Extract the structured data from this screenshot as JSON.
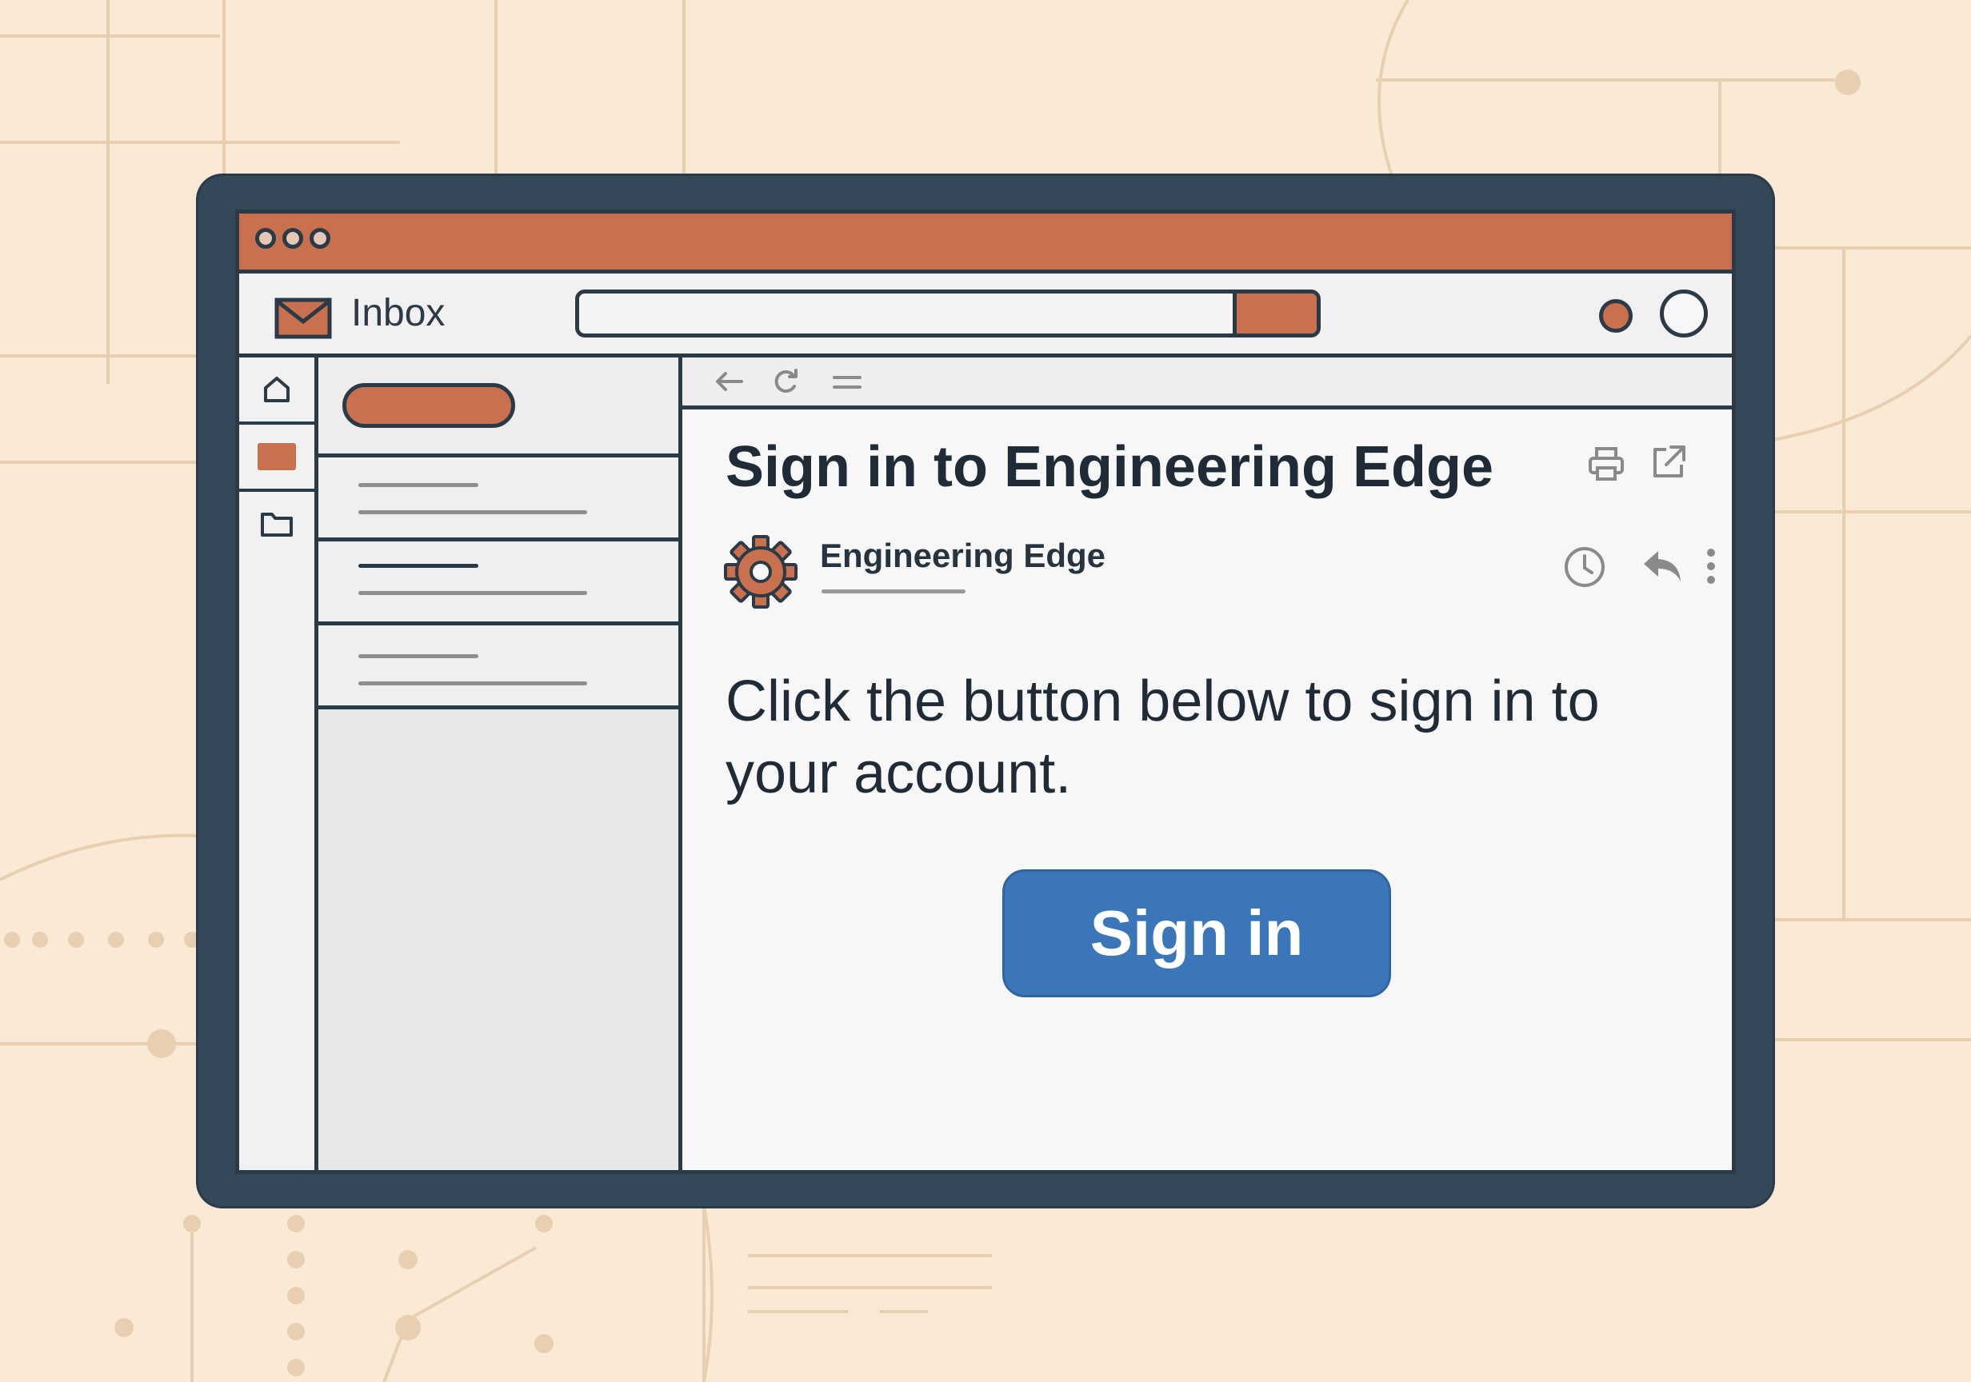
{
  "app": {
    "title": "Inbox",
    "search": {
      "value": "",
      "placeholder": ""
    }
  },
  "rail": {
    "items": [
      {
        "icon": "home-icon"
      },
      {
        "icon": "inbox-icon",
        "active": true
      },
      {
        "icon": "folder-icon"
      }
    ]
  },
  "toolbar_icons": [
    "back-arrow-icon",
    "refresh-icon",
    "menu-icon"
  ],
  "email": {
    "subject": "Sign in to Engineering Edge",
    "sender": "Engineering Edge",
    "body": "Click the button below to sign in to your account.",
    "button_label": "Sign in"
  },
  "colors": {
    "accent": "#c9704e",
    "button": "#3a76b8",
    "frame": "#35485a",
    "background": "#f9e9d5"
  }
}
